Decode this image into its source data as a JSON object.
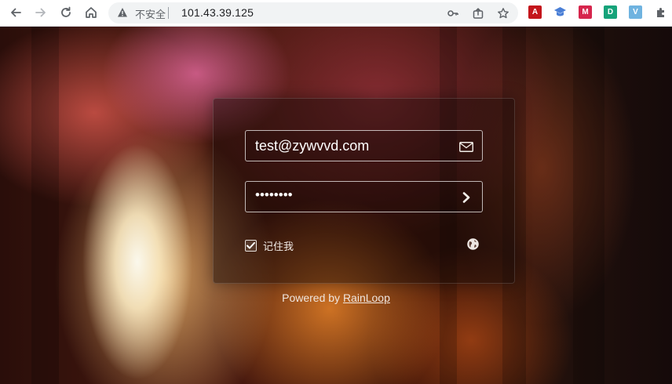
{
  "browser": {
    "insecure_label": "不安全",
    "url": "101.43.39.125",
    "extensions": [
      {
        "name": "acrobat-icon",
        "glyph": "A",
        "color": "#c4161c"
      },
      {
        "name": "graduation-cap-icon",
        "glyph": "",
        "color": "#4a7fd6"
      },
      {
        "name": "mendeley-icon",
        "glyph": "M",
        "color": "#d6264d"
      },
      {
        "name": "d-extension-icon",
        "glyph": "D",
        "color": "#16a37a"
      },
      {
        "name": "v-extension-icon",
        "glyph": "V",
        "color": "#6fb3e0"
      }
    ]
  },
  "login": {
    "email_value": "test@zywvvd.com",
    "password_value": "••••••••",
    "remember_label": "记住我",
    "remember_checked": true
  },
  "footer": {
    "powered_prefix": "Powered by ",
    "powered_link": "RainLoop"
  }
}
